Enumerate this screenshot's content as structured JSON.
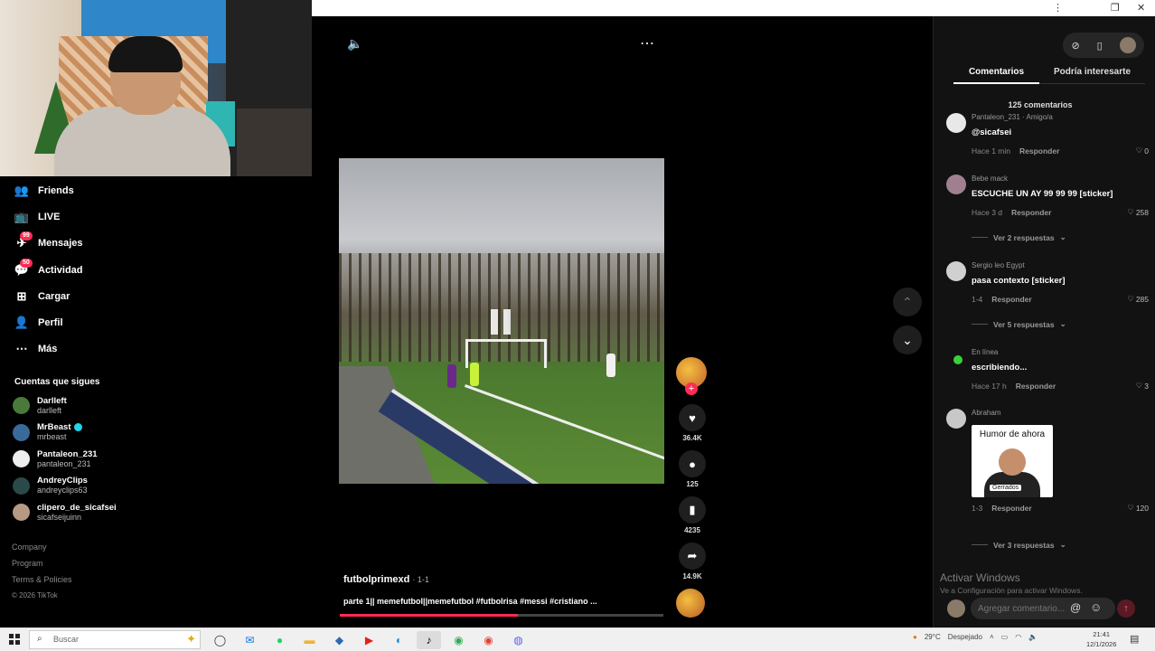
{
  "window": {
    "menu_icon": "⋮",
    "restore_icon": "❐",
    "close_icon": "✕"
  },
  "sidebar": {
    "items": [
      {
        "label": "Friends",
        "icon": "friends-icon"
      },
      {
        "label": "LIVE",
        "icon": "live-icon"
      },
      {
        "label": "Mensajes",
        "icon": "messages-icon",
        "badge": "99"
      },
      {
        "label": "Actividad",
        "icon": "activity-icon",
        "badge": "50"
      },
      {
        "label": "Cargar",
        "icon": "upload-icon"
      },
      {
        "label": "Perfil",
        "icon": "profile-icon"
      },
      {
        "label": "Más",
        "icon": "more-icon"
      }
    ],
    "following_title": "Cuentas que sigues",
    "following": [
      {
        "name": "Darlleft",
        "handle": "darlleft"
      },
      {
        "name": "MrBeast",
        "handle": "mrbeast",
        "verified": true
      },
      {
        "name": "Pantaleon_231",
        "handle": "pantaleon_231"
      },
      {
        "name": "AndreyClips",
        "handle": "andreyclips63"
      },
      {
        "name": "clipero_de_sicafsei",
        "handle": "sicafseijuinn"
      }
    ],
    "footer": [
      "Company",
      "Program",
      "Terms & Policies",
      "© 2026 TikTok"
    ]
  },
  "video": {
    "author": "futbolprimexd",
    "author_suffix": "· 1-1",
    "caption": "parte 1|| memefutbol||memefutbol #futbolrisa #messi #cristiano ...",
    "progress": 0.55,
    "actions": {
      "likes": "36.4K",
      "comments": "125",
      "saves": "4235",
      "shares": "14.9K"
    }
  },
  "panel": {
    "tabs": [
      "Comentarios",
      "Podría interesarte"
    ],
    "comment_count": "125 comentarios",
    "comments": [
      {
        "user": "Pantaleon_231 · Amigo/a",
        "text": "@sicafsei",
        "time": "Hace 1 min",
        "reply": "Responder",
        "likes": "0"
      },
      {
        "user": "Bebe mack",
        "text": "ESCUCHE UN AY 99 99 99 [sticker]",
        "time": "Hace 3 d",
        "reply": "Responder",
        "likes": "258",
        "more": "Ver 2 respuestas"
      },
      {
        "user": "Sergio leo Egypt",
        "text": "pasa contexto [sticker]",
        "time": "1-4",
        "reply": "Responder",
        "likes": "285",
        "more": "Ver 5 respuestas"
      },
      {
        "user": "En línea",
        "text": "escribiendo...",
        "time": "Hace 17 h",
        "reply": "Responder",
        "likes": "3"
      },
      {
        "user": "Abraham",
        "text": "",
        "time": "1-3",
        "reply": "Responder",
        "likes": "120",
        "more": "Ver 3 respuestas",
        "meme_text": "Humor de ahora",
        "meme_label": "Gerrados"
      }
    ],
    "watermark_title": "Activar Windows",
    "watermark_sub": "Ve a Configuración para activar Windows.",
    "composer_placeholder": "Agregar comentario..."
  },
  "taskbar": {
    "search_placeholder": "Buscar",
    "weather": "29°C",
    "weather_desc": "Despejado",
    "time": "21:41",
    "date": "12/1/2026"
  }
}
